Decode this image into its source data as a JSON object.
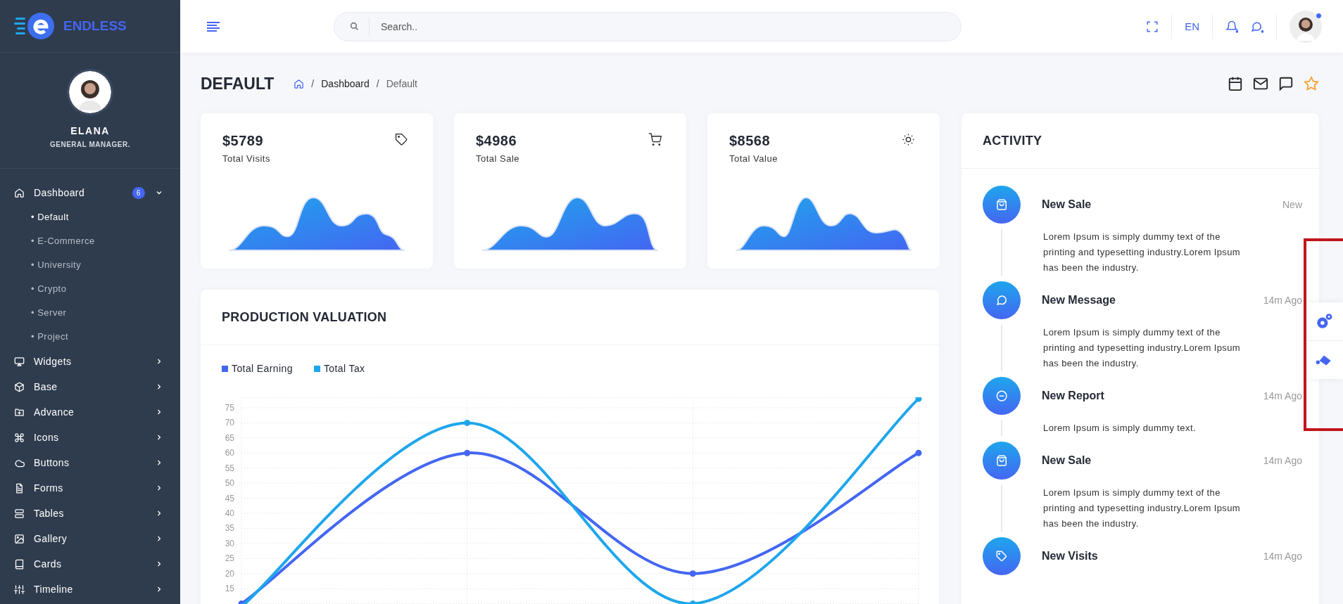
{
  "brand": {
    "name": "ENDLESS"
  },
  "profile": {
    "name": "ELANA",
    "role": "GENERAL MANAGER."
  },
  "sidebar": {
    "items": [
      {
        "label": "Dashboard",
        "badge": "6",
        "expanded": true,
        "children": [
          {
            "label": "• Default",
            "selected": true
          },
          {
            "label": "• E-Commerce",
            "selected": false
          },
          {
            "label": "• University",
            "selected": false
          },
          {
            "label": "• Crypto",
            "selected": false
          },
          {
            "label": "• Server",
            "selected": false
          },
          {
            "label": "• Project",
            "selected": false
          }
        ]
      },
      {
        "label": "Widgets",
        "expanded": false
      },
      {
        "label": "Base",
        "expanded": false
      },
      {
        "label": "Advance",
        "expanded": false
      },
      {
        "label": "Icons",
        "expanded": false
      },
      {
        "label": "Buttons",
        "expanded": false
      },
      {
        "label": "Forms",
        "expanded": false
      },
      {
        "label": "Tables",
        "expanded": false
      },
      {
        "label": "Gallery",
        "expanded": false
      },
      {
        "label": "Cards",
        "expanded": false
      },
      {
        "label": "Timeline",
        "expanded": false
      }
    ]
  },
  "topbar": {
    "search": {
      "placeholder": "Search.."
    },
    "language": "EN"
  },
  "page_header": {
    "title": "DEFAULT",
    "breadcrumb": [
      "Dashboard",
      "Default"
    ],
    "separator": "/"
  },
  "stats": [
    {
      "value": "$5789",
      "label": "Total Visits"
    },
    {
      "value": "$4986",
      "label": "Total Sale"
    },
    {
      "value": "$8568",
      "label": "Total Value"
    }
  ],
  "production": {
    "title": "PRODUCTION VALUATION",
    "chart_data": {
      "type": "line",
      "grid": true,
      "marker": true,
      "series": [
        {
          "name": "Total Earning",
          "color": "#4466f2",
          "values": [
            10,
            60,
            20,
            60
          ]
        },
        {
          "name": "Total Tax",
          "color": "#1ea6ec",
          "values": [
            9,
            70,
            10,
            78
          ]
        }
      ],
      "ylim": [
        8.5,
        78.5
      ],
      "yticks": [
        15,
        20,
        25,
        30,
        35,
        40,
        45,
        50,
        55,
        60,
        65,
        70,
        75
      ]
    }
  },
  "activity": {
    "title": "ACTIVITY",
    "items": [
      {
        "title": "New Sale",
        "time": "New",
        "text": "Lorem Ipsum is simply dummy text of the printing and typesetting industry.Lorem Ipsum has been the industry."
      },
      {
        "title": "New Message",
        "time": "14m Ago",
        "text": "Lorem Ipsum is simply dummy text of the printing and typesetting industry.Lorem Ipsum has been the industry."
      },
      {
        "title": "New Report",
        "time": "14m Ago",
        "text": "Lorem Ipsum is simply dummy text."
      },
      {
        "title": "New Sale",
        "time": "14m Ago",
        "text": "Lorem Ipsum is simply dummy text of the printing and typesetting industry.Lorem Ipsum has been the industry."
      },
      {
        "title": "New Visits",
        "time": "14m Ago"
      }
    ]
  }
}
